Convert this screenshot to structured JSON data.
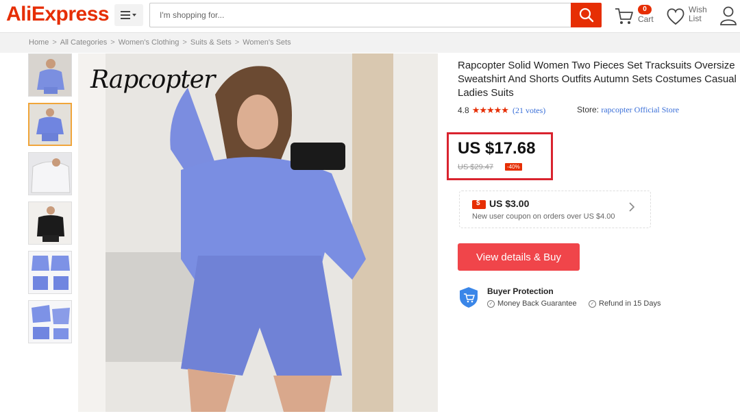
{
  "header": {
    "logo": "AliExpress",
    "search_placeholder": "I'm shopping for...",
    "cart_count": "0",
    "cart_label": "Cart",
    "wish_label": "Wish List",
    "accent_color": "#e62e04"
  },
  "breadcrumb": [
    "Home",
    "All Categories",
    "Women's Clothing",
    "Suits & Sets",
    "Women's Sets"
  ],
  "breadcrumb_separator": ">",
  "gallery": {
    "watermark": "Rapcopter",
    "thumbnails": [
      "thumb-1",
      "thumb-2",
      "thumb-3",
      "thumb-4",
      "thumb-5",
      "thumb-6"
    ],
    "active_index": 1
  },
  "product": {
    "title": "Rapcopter Solid Women Two Pieces Set Tracksuits Oversize Sweatshirt And Shorts Outfits Autumn Sets Costumes Casual Ladies Suits",
    "rating": "4.8",
    "rating_fraction": 0.96,
    "stars": "★★★★★",
    "votes": "(21 votes)",
    "store_label": "Store:",
    "store_name": "rapcopter Official Store",
    "price": "US $17.68",
    "original_price": "US $29.47",
    "discount": "-40%"
  },
  "coupon": {
    "amount": "US $3.00",
    "description": "New user coupon on orders over US $4.00"
  },
  "buy_button": "View details & Buy",
  "protection": {
    "title": "Buyer Protection",
    "items": [
      "Money Back Guarantee",
      "Refund in 15 Days"
    ]
  }
}
